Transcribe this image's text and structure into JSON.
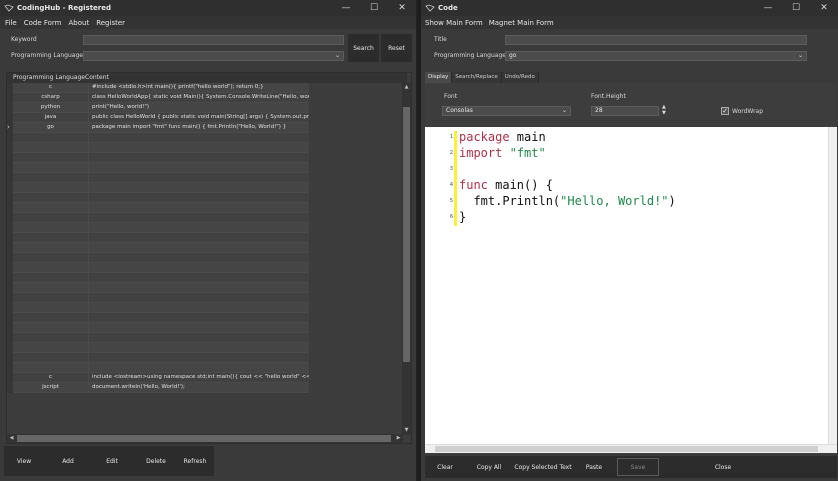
{
  "left_window": {
    "title": "CodingHub - Registered",
    "menu": [
      "File",
      "Code Form",
      "About",
      "Register"
    ],
    "search": {
      "keyword_label": "Keyword",
      "keyword_value": "",
      "language_label": "Programming Language",
      "language_value": "",
      "search_button": "Search",
      "reset_button": "Reset"
    },
    "grid": {
      "columns": [
        "Programming Language",
        "Content"
      ],
      "rows": [
        {
          "language": "c",
          "content": "#include <stdio.h>int main(){ printf(\"hello world\"); return 0;}"
        },
        {
          "language": "csharp",
          "content": "class HelloWorldApp{ static void Main(){ System.Console.WriteLine(\"Hello, world"
        },
        {
          "language": "python",
          "content": "print(\"Hello, world!\")"
        },
        {
          "language": "java",
          "content": "public class HelloWorld { public static void main(String[] args) {   System.out.pri"
        },
        {
          "language": "go",
          "content": "package main import \"fmt\" func main() {   fmt.Println(\"Hello, World!\") }"
        },
        {
          "language": "",
          "content": ""
        },
        {
          "language": "",
          "content": ""
        },
        {
          "language": "",
          "content": ""
        },
        {
          "language": "",
          "content": ""
        },
        {
          "language": "",
          "content": ""
        },
        {
          "language": "",
          "content": ""
        },
        {
          "language": "",
          "content": ""
        },
        {
          "language": "",
          "content": ""
        },
        {
          "language": "",
          "content": ""
        },
        {
          "language": "",
          "content": ""
        },
        {
          "language": "",
          "content": ""
        },
        {
          "language": "",
          "content": ""
        },
        {
          "language": "",
          "content": ""
        },
        {
          "language": "",
          "content": ""
        },
        {
          "language": "",
          "content": ""
        },
        {
          "language": "",
          "content": ""
        },
        {
          "language": "",
          "content": ""
        },
        {
          "language": "",
          "content": ""
        },
        {
          "language": "",
          "content": ""
        },
        {
          "language": "",
          "content": ""
        },
        {
          "language": "",
          "content": ""
        },
        {
          "language": "",
          "content": ""
        },
        {
          "language": "",
          "content": ""
        },
        {
          "language": "",
          "content": ""
        },
        {
          "language": "c",
          "content": "include <iostream>using namespace std;int main(){  cout << \"hello world\" << en"
        },
        {
          "language": "jscript",
          "content": "document.writeln('Hello, World!');"
        }
      ]
    },
    "toolbar": [
      "View",
      "Add",
      "Edit",
      "Delete",
      "Refresh"
    ]
  },
  "right_window": {
    "title": "Code",
    "menu": [
      "Show Main Form",
      "Magnet Main Form"
    ],
    "title_label": "Title",
    "title_value": "",
    "language_label": "Programming Language",
    "language_value": "go",
    "tabs": [
      "Display",
      "Search/Replace",
      "Undo/Redo"
    ],
    "font_label": "Font",
    "font_value": "Consolas",
    "font_height_label": "Font.Height",
    "font_height_value": "28",
    "wordwrap_label": "WordWrap",
    "wordwrap_checked": true,
    "editor_lines": [
      "1",
      "2",
      "3",
      "4",
      "5",
      "6"
    ],
    "toolbar": [
      "Clear",
      "Copy All",
      "Copy Selected Text",
      "Paste",
      "Save",
      "Close"
    ]
  }
}
